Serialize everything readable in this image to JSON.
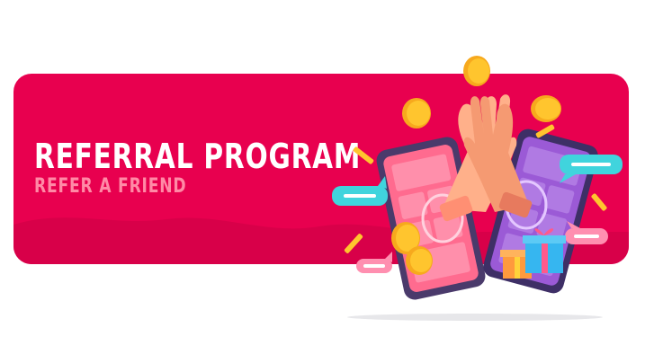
{
  "banner": {
    "title": "REFERRAL PROGRAM",
    "subtitle": "REFER A FRIEND"
  },
  "colors": {
    "background": "#e8004f",
    "wave": "#d80049",
    "title": "#ffffff",
    "subtitle": "#ff8aa6",
    "coin": "#ffc52e",
    "phone_left": "#ff6b8f",
    "phone_right": "#9b5ad6",
    "chat_bubble": "#40d4dd",
    "gift": "#36b6f0"
  },
  "icons": [
    "gold-coin-icon",
    "smartphone-icon",
    "high-five-hands-icon",
    "chat-bubble-icon",
    "gift-box-icon",
    "confetti-icon"
  ]
}
